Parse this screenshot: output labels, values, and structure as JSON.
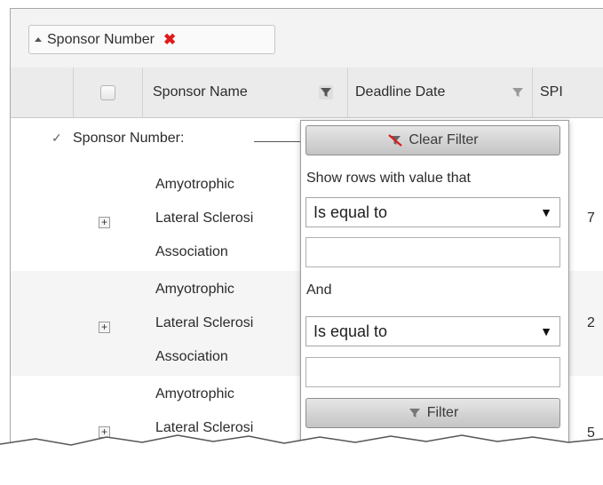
{
  "group_bar": {
    "tag_label": "Sponsor Number",
    "remove_glyph": "✖"
  },
  "columns": {
    "sponsor_name": "Sponsor Name",
    "deadline_date": "Deadline Date",
    "next_partial": "SPI"
  },
  "group_row": {
    "label": "Sponsor Number:"
  },
  "rows": [
    {
      "name_lines": [
        "Amyotrophic",
        "Lateral Sclerosi",
        "Association"
      ],
      "value_partial": "7"
    },
    {
      "name_lines": [
        "Amyotrophic",
        "Lateral Sclerosi",
        "Association"
      ],
      "value_partial": "2"
    },
    {
      "name_lines": [
        "Amyotrophic",
        "Lateral Sclerosi",
        ""
      ],
      "value_partial": "5"
    }
  ],
  "filter_popup": {
    "clear_button": "Clear Filter",
    "instruction": "Show rows with value that",
    "operator1": "Is equal to",
    "conjunction": "And",
    "operator2": "Is equal to",
    "filter_button": "Filter"
  },
  "icons": {
    "sort": "sort-ascending-icon",
    "remove": "remove-icon",
    "filter": "funnel-icon",
    "clear_filter": "clear-filter-icon",
    "expand": "plus-icon",
    "collapse": "chevron-down-icon"
  },
  "colors": {
    "remove_icon": "#e0191a",
    "header_bg": "#ebebeb",
    "alt_row": "#f5f5f5"
  }
}
